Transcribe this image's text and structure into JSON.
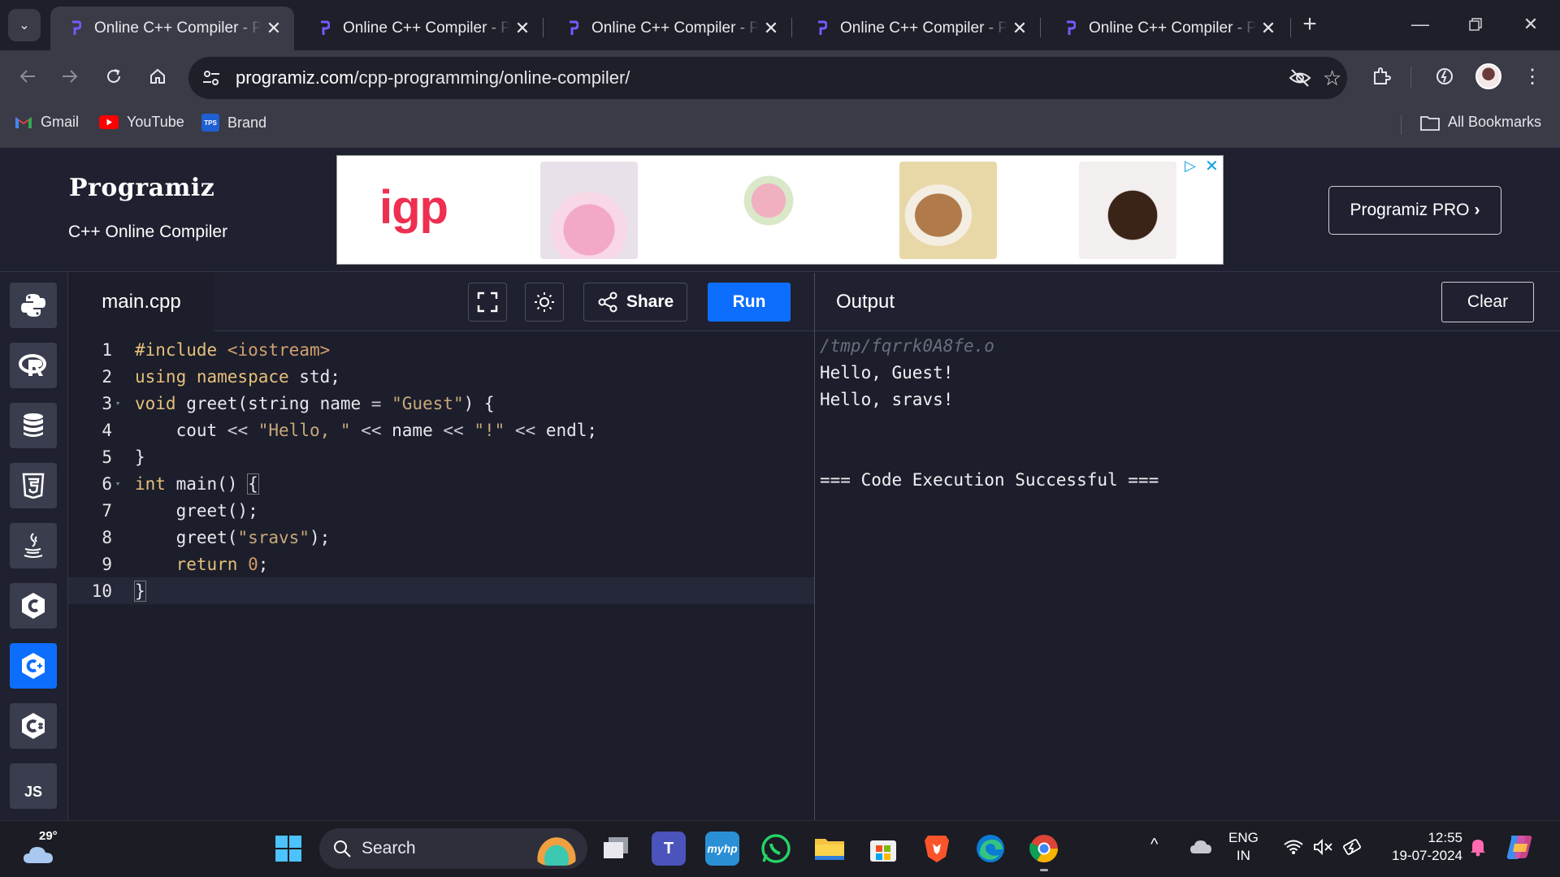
{
  "browser": {
    "tabs": [
      {
        "title": "Online C++ Compiler - Programiz",
        "active": true
      },
      {
        "title": "Online C++ Compiler - Programiz",
        "active": false
      },
      {
        "title": "Online C++ Compiler - Programiz",
        "active": false
      },
      {
        "title": "Online C++ Compiler - Programiz",
        "active": false
      },
      {
        "title": "Online C++ Compiler - Programiz",
        "active": false
      }
    ],
    "new_tab_glyph": "+",
    "url_host": "programiz.com",
    "url_path": "/cpp-programming/online-compiler/",
    "bookmarks": [
      {
        "label": "Gmail",
        "icon": "gmail-icon"
      },
      {
        "label": "YouTube",
        "icon": "youtube-icon"
      },
      {
        "label": "Brand",
        "icon": "tps-icon"
      }
    ],
    "all_bookmarks": "All Bookmarks"
  },
  "site": {
    "logo": "Programiz",
    "subtitle": "C++ Online Compiler",
    "pro_button": "Programiz PRO",
    "ad_brand": "igp",
    "accent": "#0d6efd"
  },
  "sidebar": {
    "languages": [
      {
        "name": "python",
        "icon": "python-icon",
        "active": false
      },
      {
        "name": "r",
        "icon": "r-icon",
        "active": false
      },
      {
        "name": "sql",
        "icon": "database-icon",
        "active": false
      },
      {
        "name": "html",
        "icon": "html5-icon",
        "active": false
      },
      {
        "name": "java",
        "icon": "java-icon",
        "active": false
      },
      {
        "name": "c",
        "icon": "c-icon",
        "active": false
      },
      {
        "name": "cpp",
        "icon": "cpp-icon",
        "active": true
      },
      {
        "name": "csharp",
        "icon": "csharp-icon",
        "active": false
      },
      {
        "name": "js",
        "icon": "js-icon",
        "label": "JS",
        "active": false
      }
    ]
  },
  "editor": {
    "file_name": "main.cpp",
    "share_label": "Share",
    "run_label": "Run",
    "line_numbers": [
      "1",
      "2",
      "3",
      "4",
      "5",
      "6",
      "7",
      "8",
      "9",
      "10"
    ],
    "current_line": 10
  },
  "output": {
    "title": "Output",
    "clear_label": "Clear",
    "lines": [
      "/tmp/fqrrk0A8fe.o",
      "Hello, Guest!",
      "Hello, sravs!",
      "",
      "",
      "=== Code Execution Successful ==="
    ]
  },
  "taskbar": {
    "weather_temp": "29°",
    "search_placeholder": "Search",
    "lang_top": "ENG",
    "lang_bottom": "IN",
    "time": "12:55",
    "date": "19-07-2024"
  }
}
